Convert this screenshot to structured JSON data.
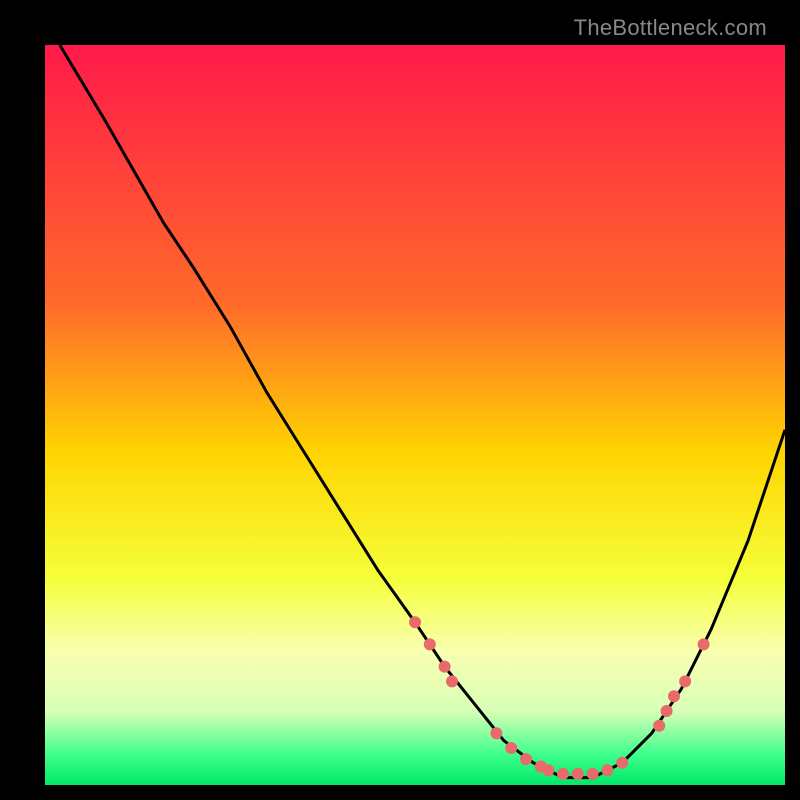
{
  "attribution": "TheBottleneck.com",
  "chart_data": {
    "type": "line",
    "title": "",
    "xlabel": "",
    "ylabel": "",
    "xlim": [
      0,
      100
    ],
    "ylim": [
      0,
      100
    ],
    "gradient_stops": [
      {
        "offset": 0,
        "color": "#ff1a4a"
      },
      {
        "offset": 35,
        "color": "#ff6a2a"
      },
      {
        "offset": 55,
        "color": "#ffd400"
      },
      {
        "offset": 72,
        "color": "#f5ff3a"
      },
      {
        "offset": 82,
        "color": "#f8ffb0"
      },
      {
        "offset": 90,
        "color": "#d8ffb8"
      },
      {
        "offset": 96,
        "color": "#3cff8a"
      },
      {
        "offset": 100,
        "color": "#00e868"
      }
    ],
    "series": [
      {
        "name": "bottleneck-curve",
        "color": "#000000",
        "x": [
          2,
          5,
          8,
          12,
          16,
          20,
          25,
          30,
          35,
          40,
          45,
          50,
          54,
          58,
          62,
          66,
          70,
          74,
          78,
          82,
          86,
          90,
          95,
          100
        ],
        "y": [
          100,
          95,
          90,
          83,
          76,
          70,
          62,
          53,
          45,
          37,
          29,
          22,
          16,
          11,
          6,
          3,
          1,
          1,
          3,
          7,
          13,
          21,
          33,
          48
        ]
      }
    ],
    "markers": {
      "name": "highlight-points",
      "color": "#e86a6a",
      "radius": 6,
      "points": [
        {
          "x": 50,
          "y": 22
        },
        {
          "x": 52,
          "y": 19
        },
        {
          "x": 54,
          "y": 16
        },
        {
          "x": 55,
          "y": 14
        },
        {
          "x": 61,
          "y": 7
        },
        {
          "x": 63,
          "y": 5
        },
        {
          "x": 65,
          "y": 3.5
        },
        {
          "x": 67,
          "y": 2.5
        },
        {
          "x": 68,
          "y": 2
        },
        {
          "x": 70,
          "y": 1.5
        },
        {
          "x": 72,
          "y": 1.5
        },
        {
          "x": 74,
          "y": 1.5
        },
        {
          "x": 76,
          "y": 2
        },
        {
          "x": 78,
          "y": 3
        },
        {
          "x": 83,
          "y": 8
        },
        {
          "x": 84,
          "y": 10
        },
        {
          "x": 85,
          "y": 12
        },
        {
          "x": 86.5,
          "y": 14
        },
        {
          "x": 89,
          "y": 19
        }
      ]
    }
  }
}
